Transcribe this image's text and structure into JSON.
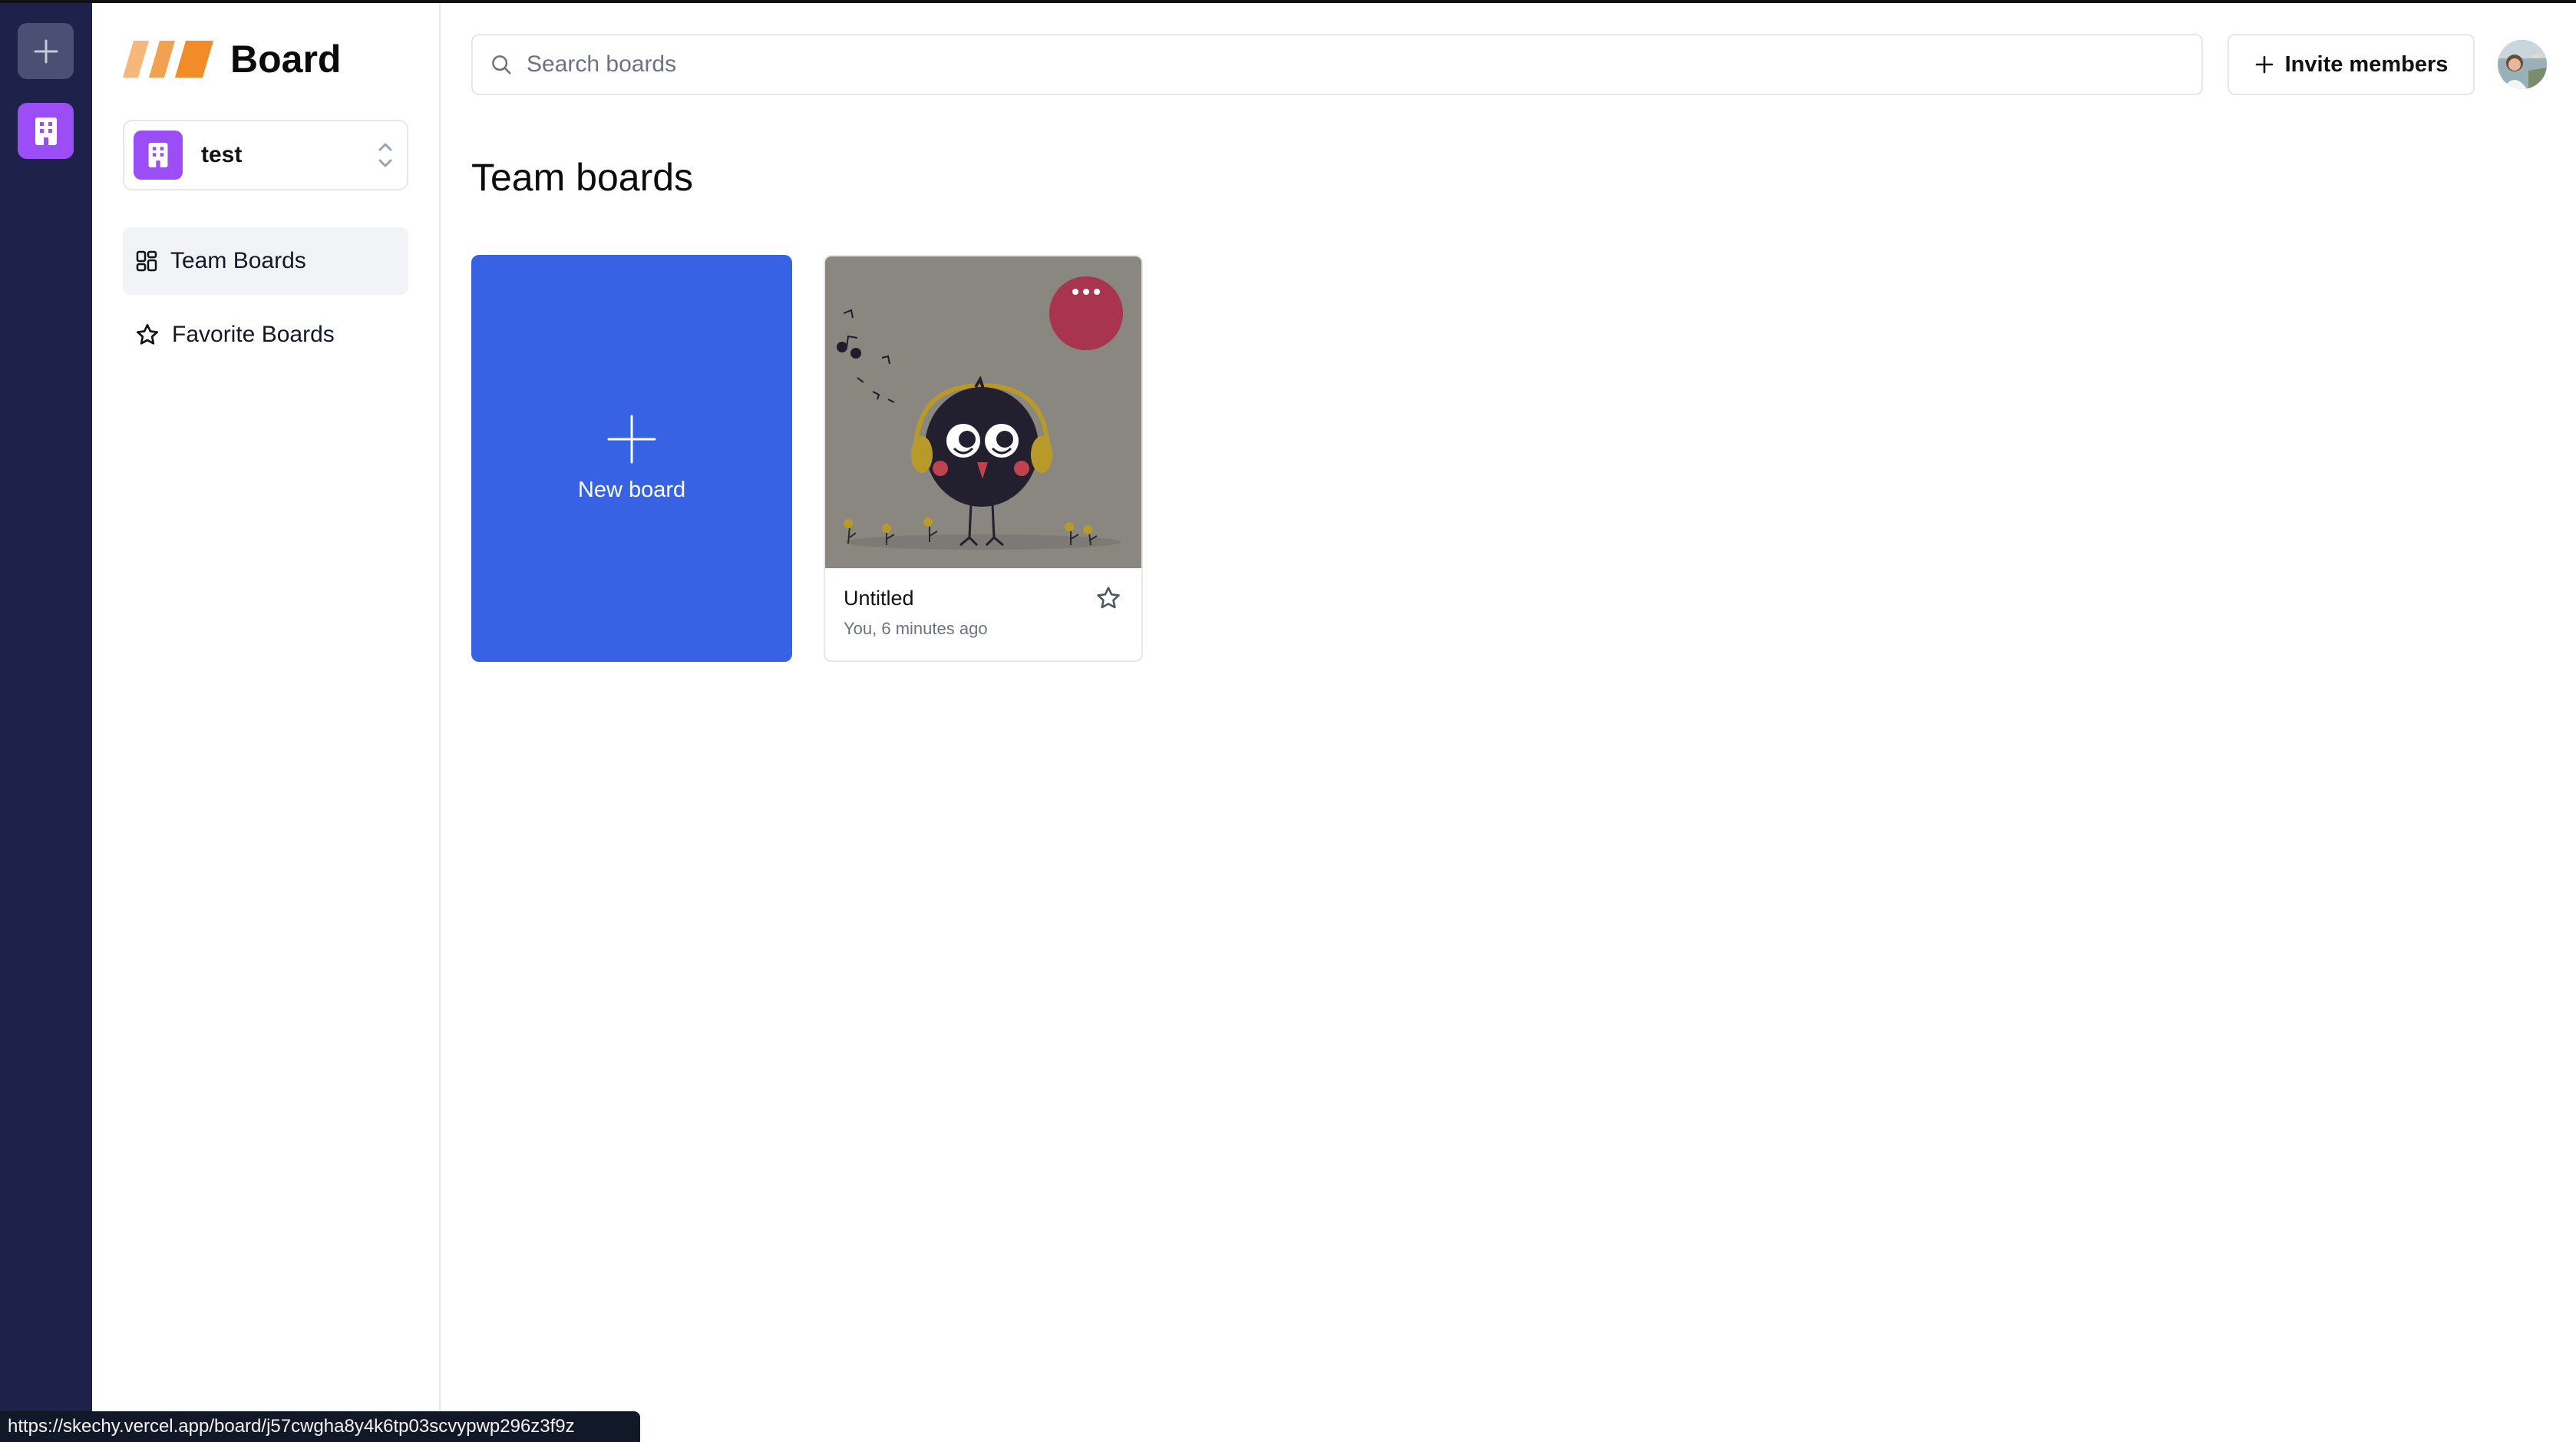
{
  "app": {
    "logo_text": "Board",
    "status_url": "https://skechy.vercel.app/board/j57cwgha8y4k6tp03scvypwp296z3f9z"
  },
  "rail": {
    "add_icon": "plus-icon",
    "org_icon": "building-icon"
  },
  "sidebar": {
    "org_name": "test",
    "items": [
      {
        "label": "Team Boards",
        "icon": "dashboard-grid-icon",
        "active": true
      },
      {
        "label": "Favorite Boards",
        "icon": "star-icon",
        "active": false
      }
    ]
  },
  "header": {
    "search_placeholder": "Search boards",
    "invite_label": "Invite members"
  },
  "main": {
    "title": "Team boards",
    "new_board_label": "New board",
    "boards": [
      {
        "title": "Untitled",
        "meta": "You, 6 minutes ago",
        "favorite": false
      }
    ]
  },
  "colors": {
    "rail_bg": "#1e2149",
    "org_purple": "#9b4ef5",
    "new_board_blue": "#3662e3",
    "logo_orange": "#f28c28"
  }
}
